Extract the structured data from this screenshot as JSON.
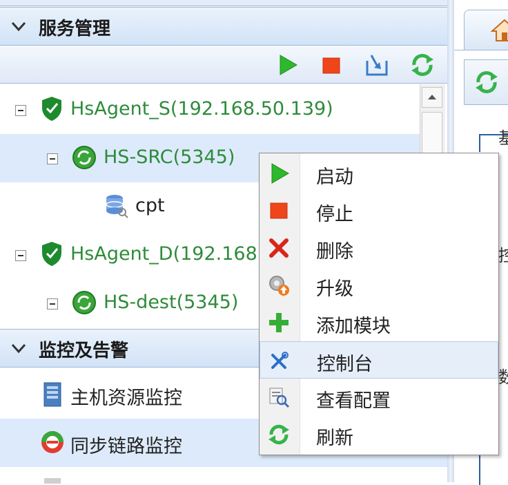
{
  "panels": {
    "service_management": "服务管理",
    "monitoring_alerts": "监控及告警"
  },
  "tree": {
    "nodes": [
      {
        "label": "HsAgent_S(192.168.50.139)",
        "type": "agent"
      },
      {
        "label": "HS-SRC(5345)",
        "type": "service"
      },
      {
        "label": "cpt",
        "type": "database"
      },
      {
        "label": "HsAgent_D(192.168.",
        "type": "agent"
      },
      {
        "label": "HS-dest(5345)",
        "type": "service"
      }
    ]
  },
  "monitoring": {
    "items": [
      {
        "label": "主机资源监控"
      },
      {
        "label": "同步链路监控"
      }
    ]
  },
  "right_panel": {
    "text1": "基",
    "text2": "控",
    "text3": "数"
  },
  "context_menu": {
    "items": [
      {
        "label": "启动",
        "icon": "play-icon"
      },
      {
        "label": "停止",
        "icon": "stop-icon"
      },
      {
        "label": "删除",
        "icon": "delete-icon"
      },
      {
        "label": "升级",
        "icon": "upgrade-icon"
      },
      {
        "label": "添加模块",
        "icon": "add-icon"
      },
      {
        "label": "控制台",
        "icon": "console-icon"
      },
      {
        "label": "查看配置",
        "icon": "view-config-icon"
      },
      {
        "label": "刷新",
        "icon": "refresh-icon"
      }
    ]
  },
  "colors": {
    "header_bg": "#d2e3f7",
    "selected_row": "#ddeafb",
    "tree_green_text": "#2e8b3a",
    "menu_hover": "#e6eefa"
  }
}
